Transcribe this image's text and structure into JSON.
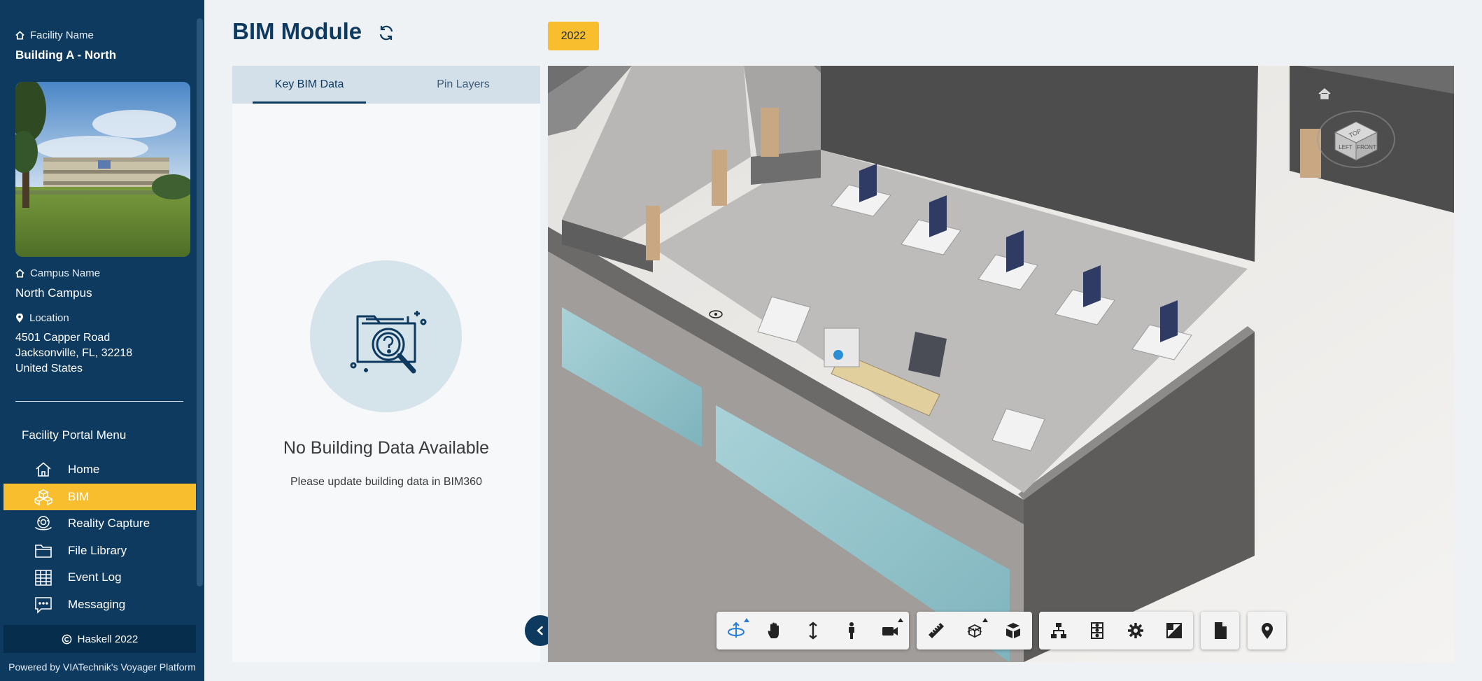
{
  "sidebar": {
    "facility_label": "Facility Name",
    "facility_name": "Building A - North",
    "campus_label": "Campus Name",
    "campus_name": "North Campus",
    "location_label": "Location",
    "address": [
      "4501 Capper Road",
      "Jacksonville, FL, 32218",
      "United States"
    ],
    "menu_title": "Facility Portal Menu",
    "menu": [
      {
        "label": "Home",
        "icon": "home-icon"
      },
      {
        "label": "BIM",
        "icon": "bim-cubes-icon",
        "active": true
      },
      {
        "label": "Reality Capture",
        "icon": "reality-capture-icon"
      },
      {
        "label": "File Library",
        "icon": "folder-icon"
      },
      {
        "label": "Event Log",
        "icon": "calendar-grid-icon"
      },
      {
        "label": "Messaging",
        "icon": "message-icon"
      }
    ],
    "copyright": "Haskell 2022",
    "powered_by": "Powered by VIATechnik's Voyager Platform",
    "active_color": "#f9be2e",
    "background_color": "#0e3a5f"
  },
  "header": {
    "title": "BIM Module",
    "refresh_icon": "refresh-icon",
    "year_badge": "2022"
  },
  "panel": {
    "tabs": [
      {
        "label": "Key BIM Data",
        "active": true
      },
      {
        "label": "Pin Layers",
        "active": false
      }
    ],
    "empty_title": "No Building Data Available",
    "empty_subtitle": "Please update building data in BIM360"
  },
  "viewer": {
    "viewcube_faces": [
      "TOP",
      "LEFT",
      "FRONT"
    ],
    "toolbar_groups": [
      [
        {
          "name": "orbit-icon",
          "active": true,
          "caret": true
        },
        {
          "name": "pan-hand-icon"
        },
        {
          "name": "zoom-icon"
        },
        {
          "name": "first-person-icon"
        },
        {
          "name": "camera-icon",
          "caret": true
        }
      ],
      [
        {
          "name": "measure-icon"
        },
        {
          "name": "section-icon",
          "caret": true
        },
        {
          "name": "explode-icon"
        }
      ],
      [
        {
          "name": "model-browser-icon"
        },
        {
          "name": "properties-icon"
        },
        {
          "name": "settings-icon"
        },
        {
          "name": "fullscreen-icon"
        }
      ],
      [
        {
          "name": "document-icon"
        }
      ],
      [
        {
          "name": "pin-icon"
        }
      ]
    ]
  }
}
